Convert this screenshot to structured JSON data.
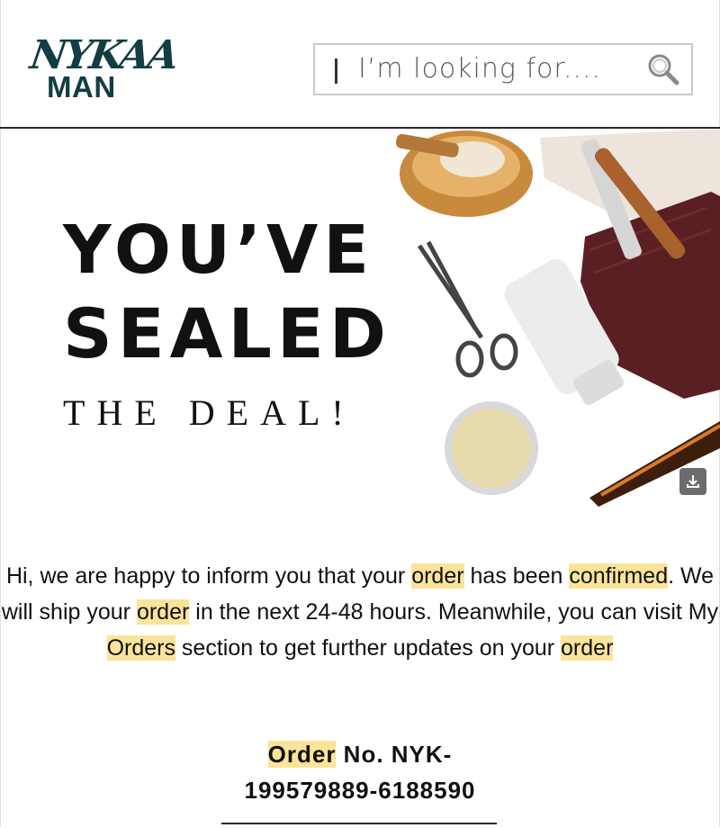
{
  "header": {
    "logo_brand": "NYKAA",
    "logo_sub": "MAN",
    "search_placeholder": "I’m looking for...."
  },
  "hero": {
    "line1": "YOU’VE",
    "line2": "SEALED",
    "line3": "THE DEAL!"
  },
  "message": {
    "p1": "Hi, we are happy to inform you that your ",
    "h1": "order",
    "p2": " has been ",
    "h2": "confirmed",
    "p3": ". We will ship your ",
    "h3": "order",
    "p4": " in the next 24-48 hours. Meanwhile, you can visit My ",
    "h4": "Orders",
    "p5": " section to get further updates on your ",
    "h5": "order"
  },
  "order": {
    "label": "Order",
    "text1": " No. NYK-",
    "number": "199579889-6188590"
  },
  "colors": {
    "brand": "#123d43",
    "highlight": "#fbe49a",
    "towel": "#5a1f22"
  }
}
